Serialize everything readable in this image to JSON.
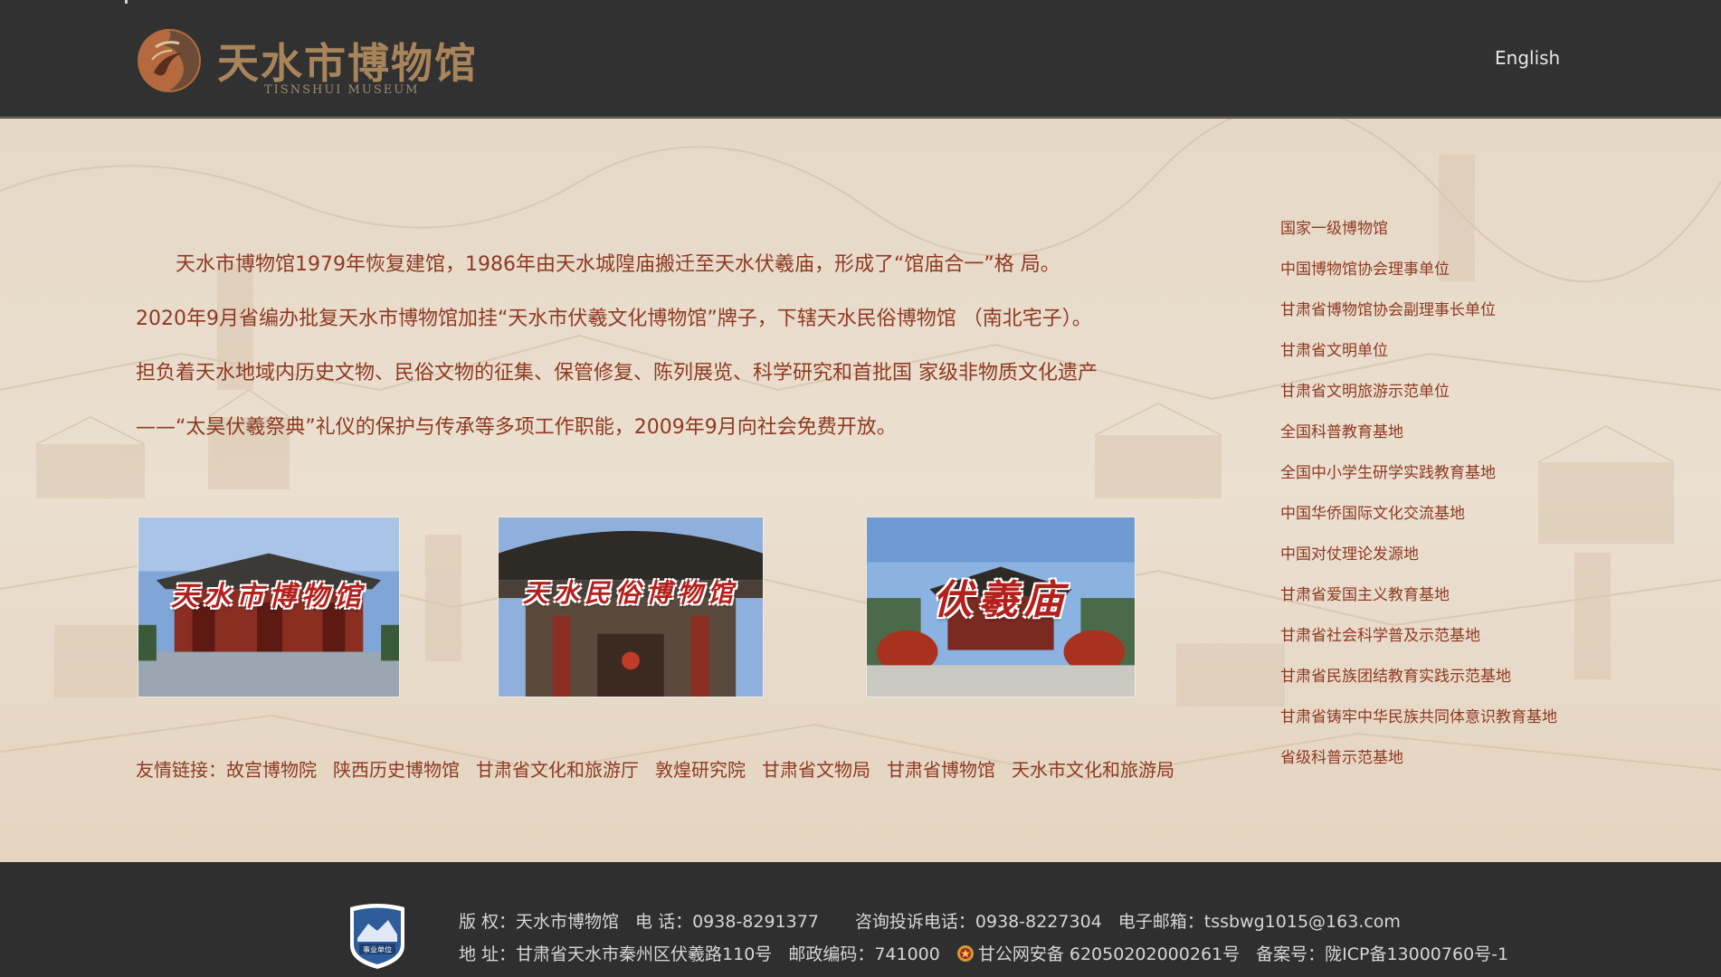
{
  "header": {
    "title": "天水市博物馆",
    "subtitle": "TISNSHUI MUSEUM",
    "language_link": "English"
  },
  "intro": {
    "lines": [
      "天水市博物馆1979年恢复建馆，1986年由天水城隍庙搬迁至天水伏羲庙，形成了“馆庙合一”格 局。",
      "2020年9月省编办批复天水市博物馆加挂“天水市伏羲文化博物馆”牌子，下辖天水民俗博物馆 （南北宅子）。",
      "担负着天水地域内历史文物、民俗文物的征集、保管修复、陈列展览、科学研究和首批国 家级非物质文化遗产",
      "——“太昊伏羲祭典”礼仪的保护与传承等多项工作职能，2009年9月向社会免费开放。"
    ]
  },
  "photos": [
    {
      "caption": "天水市博物馆"
    },
    {
      "caption": "天水民俗博物馆"
    },
    {
      "caption": "伏羲庙"
    }
  ],
  "links": {
    "label": "友情链接：",
    "items": [
      "故宫博物院",
      "陕西历史博物馆",
      "甘肃省文化和旅游厅",
      "敦煌研究院",
      "甘肃省文物局",
      "甘肃省博物馆",
      "天水市文化和旅游局"
    ]
  },
  "honors": [
    "国家一级博物馆",
    "中国博物馆协会理事单位",
    "甘肃省博物馆协会副理事长单位",
    "甘肃省文明单位",
    "甘肃省文明旅游示范单位",
    "全国科普教育基地",
    "全国中小学生研学实践教育基地",
    "中国华侨国际文化交流基地",
    "中国对仗理论发源地",
    "甘肃省爱国主义教育基地",
    "甘肃省社会科学普及示范基地",
    "甘肃省民族团结教育实践示范基地",
    "甘肃省铸牢中华民族共同体意识教育基地",
    "省级科普示范基地"
  ],
  "footer": {
    "badge_text": "事业单位",
    "copyright": "版 权：天水市博物馆",
    "phone": "电 话：0938-8291377",
    "complaint_phone": "咨询投诉电话：0938-8227304",
    "email": "电子邮箱：tssbwg1015@163.com",
    "address": "地 址：甘肃省天水市秦州区伏羲路110号",
    "postcode": "邮政编码：741000",
    "police_record": "甘公网安备 62050202000261号",
    "icp": "备案号：陇ICP备13000760号-1"
  }
}
